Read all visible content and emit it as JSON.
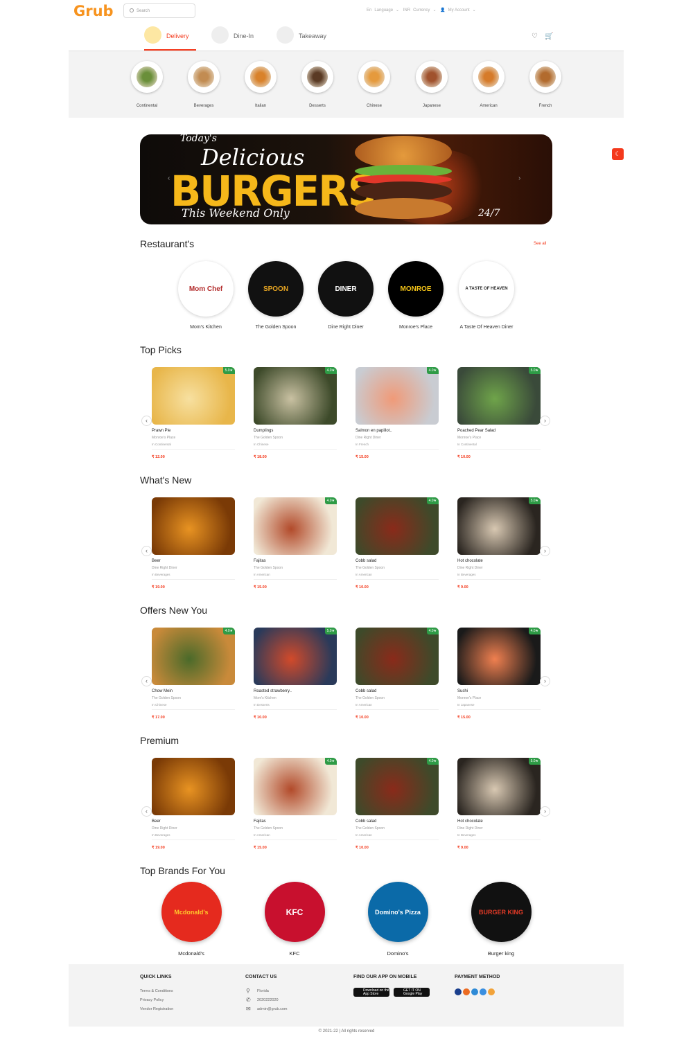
{
  "header": {
    "logo": "Grub",
    "search_placeholder": "Search",
    "lang": "En",
    "language_label": "Language",
    "currency_code": "INR",
    "currency_label": "Currency",
    "account_label": "My Account",
    "tabs": [
      {
        "label": "Delivery"
      },
      {
        "label": "Dine-In"
      },
      {
        "label": "Takeaway"
      }
    ]
  },
  "categories": [
    {
      "label": "Continental",
      "color": "#6a8f3a"
    },
    {
      "label": "Beverages",
      "color": "#c28c52"
    },
    {
      "label": "Italian",
      "color": "#d9822b"
    },
    {
      "label": "Desserts",
      "color": "#5a3a24"
    },
    {
      "label": "Chinese",
      "color": "#e59a3d"
    },
    {
      "label": "Japanese",
      "color": "#a0522d"
    },
    {
      "label": "American",
      "color": "#d67b2a"
    },
    {
      "label": "French",
      "color": "#b26b2e"
    }
  ],
  "banner": {
    "line1": "Today's",
    "line2": "Delicious",
    "line3": "BURGERS",
    "line4": "This Weekend Only",
    "line5": "24/7"
  },
  "restaurants_section": {
    "title": "Restaurant's",
    "see_all": "See all",
    "items": [
      {
        "name": "Mom's Kitchen",
        "logo_text": "Mom Chef",
        "bg": "#ffffff",
        "fg": "#b22a2a"
      },
      {
        "name": "The Golden Spoon",
        "logo_text": "SPOON",
        "bg": "#111111",
        "fg": "#e8a623"
      },
      {
        "name": "Dine Right Diner",
        "logo_text": "DINER",
        "bg": "#111111",
        "fg": "#ffffff"
      },
      {
        "name": "Monroe's Place",
        "logo_text": "MONROE",
        "bg": "#000000",
        "fg": "#f3c318"
      },
      {
        "name": "A Taste Of Heaven Diner",
        "logo_text": "A TASTE OF HEAVEN",
        "bg": "#ffffff",
        "fg": "#222222"
      }
    ]
  },
  "sections": [
    {
      "title": "Top Picks",
      "items": [
        {
          "name": "Prawn Pie",
          "restaurant": "Monroe's Place",
          "category": "In Continental",
          "price": "₹ 12.00",
          "rating": "5.0★",
          "c1": "#e8b64a",
          "c2": "#f7e0a0"
        },
        {
          "name": "Dumplings",
          "restaurant": "The Golden Spoon",
          "category": "In Chinese",
          "price": "₹ 18.00",
          "rating": "4.0★",
          "c1": "#3d4a2a",
          "c2": "#c9c1a2"
        },
        {
          "name": "Salmon en papillot..",
          "restaurant": "Dine Right Diner",
          "category": "In French",
          "price": "₹ 15.00",
          "rating": "4.0★",
          "c1": "#c9ccd2",
          "c2": "#f09a78"
        },
        {
          "name": "Poached Pear Salad",
          "restaurant": "Monroe's Place",
          "category": "In Continental",
          "price": "₹ 10.00",
          "rating": "5.0★",
          "c1": "#3a4a3a",
          "c2": "#6fa44a"
        }
      ]
    },
    {
      "title": "What's New",
      "items": [
        {
          "name": "Beer",
          "restaurant": "Dine Right Diner",
          "category": "In Beverages",
          "price": "₹ 19.00",
          "rating": "",
          "c1": "#7a3a06",
          "c2": "#e89322"
        },
        {
          "name": "Fajitas",
          "restaurant": "The Golden Spoon",
          "category": "In American",
          "price": "₹ 15.00",
          "rating": "4.0★",
          "c1": "#f1e8d6",
          "c2": "#b24a2a"
        },
        {
          "name": "Cobb salad",
          "restaurant": "The Golden Spoon",
          "category": "In American",
          "price": "₹ 10.00",
          "rating": "4.0★",
          "c1": "#3e4a2a",
          "c2": "#8a2a1a"
        },
        {
          "name": "Hot chocolate",
          "restaurant": "Dine Right Diner",
          "category": "In Beverages",
          "price": "₹ 9.00",
          "rating": "5.0★",
          "c1": "#2a2520",
          "c2": "#d8c8b2"
        }
      ]
    },
    {
      "title": "Offers New You",
      "items": [
        {
          "name": "Chow Mein",
          "restaurant": "The Golden Spoon",
          "category": "In Chinese",
          "price": "₹ 17.00",
          "rating": "4.0★",
          "c1": "#c98a3a",
          "c2": "#4a6a2a"
        },
        {
          "name": "Roasted strawberry..",
          "restaurant": "Mom's Kitchen",
          "category": "In Desserts",
          "price": "₹ 10.00",
          "rating": "5.0★",
          "c1": "#2a3a5a",
          "c2": "#d24a2a"
        },
        {
          "name": "Cobb salad",
          "restaurant": "The Golden Spoon",
          "category": "In American",
          "price": "₹ 10.00",
          "rating": "4.0★",
          "c1": "#3e4a2a",
          "c2": "#8a2a1a"
        },
        {
          "name": "Sushi",
          "restaurant": "Monroe's Place",
          "category": "In Japanese",
          "price": "₹ 15.00",
          "rating": "4.0★",
          "c1": "#1a1a1a",
          "c2": "#f08050"
        }
      ]
    },
    {
      "title": "Premium",
      "items": [
        {
          "name": "Beer",
          "restaurant": "Dine Right Diner",
          "category": "In Beverages",
          "price": "₹ 19.00",
          "rating": "",
          "c1": "#7a3a06",
          "c2": "#e89322"
        },
        {
          "name": "Fajitas",
          "restaurant": "The Golden Spoon",
          "category": "In American",
          "price": "₹ 15.00",
          "rating": "4.0★",
          "c1": "#f1e8d6",
          "c2": "#b24a2a"
        },
        {
          "name": "Cobb salad",
          "restaurant": "The Golden Spoon",
          "category": "In American",
          "price": "₹ 10.00",
          "rating": "4.0★",
          "c1": "#3e4a2a",
          "c2": "#8a2a1a"
        },
        {
          "name": "Hot chocolate",
          "restaurant": "Dine Right Diner",
          "category": "In Beverages",
          "price": "₹ 9.00",
          "rating": "5.0★",
          "c1": "#2a2520",
          "c2": "#d8c8b2"
        }
      ]
    }
  ],
  "brands_section": {
    "title": "Top Brands For You",
    "items": [
      {
        "name": "Mcdonald's",
        "logo_text": "Mcdonald's",
        "bg": "#e52a1e",
        "fg": "#ffc72c"
      },
      {
        "name": "KFC",
        "logo_text": "KFC",
        "bg": "#c8102e",
        "fg": "#ffffff"
      },
      {
        "name": "Domino's",
        "logo_text": "Domino's Pizza",
        "bg": "#0b6aa8",
        "fg": "#ffffff"
      },
      {
        "name": "Burger king",
        "logo_text": "BURGER KING",
        "bg": "#111111",
        "fg": "#e33a26"
      }
    ]
  },
  "footer": {
    "quick_links_title": "QUICK LINKS",
    "quick_links": [
      "Terms & Conditions",
      "Privacy Policy",
      "Vendor Registration"
    ],
    "contact_title": "CONTACT US",
    "contact": {
      "location": "Florida",
      "phone": "2020222020",
      "email": "admin@grub.com"
    },
    "app_title": "FIND OUR APP ON MOBILE",
    "app_store": {
      "small": "Download on the",
      "big": "App Store"
    },
    "play_store": {
      "small": "GET IT ON",
      "big": "Google Play"
    },
    "payment_title": "PAYMENT METHOD",
    "payment_colors": [
      "#1a3e8c",
      "#eb6b22",
      "#2e8ad6",
      "#3a8fe0",
      "#f2a33a"
    ]
  },
  "copyright": "© 2021-22 | All rights reserved"
}
